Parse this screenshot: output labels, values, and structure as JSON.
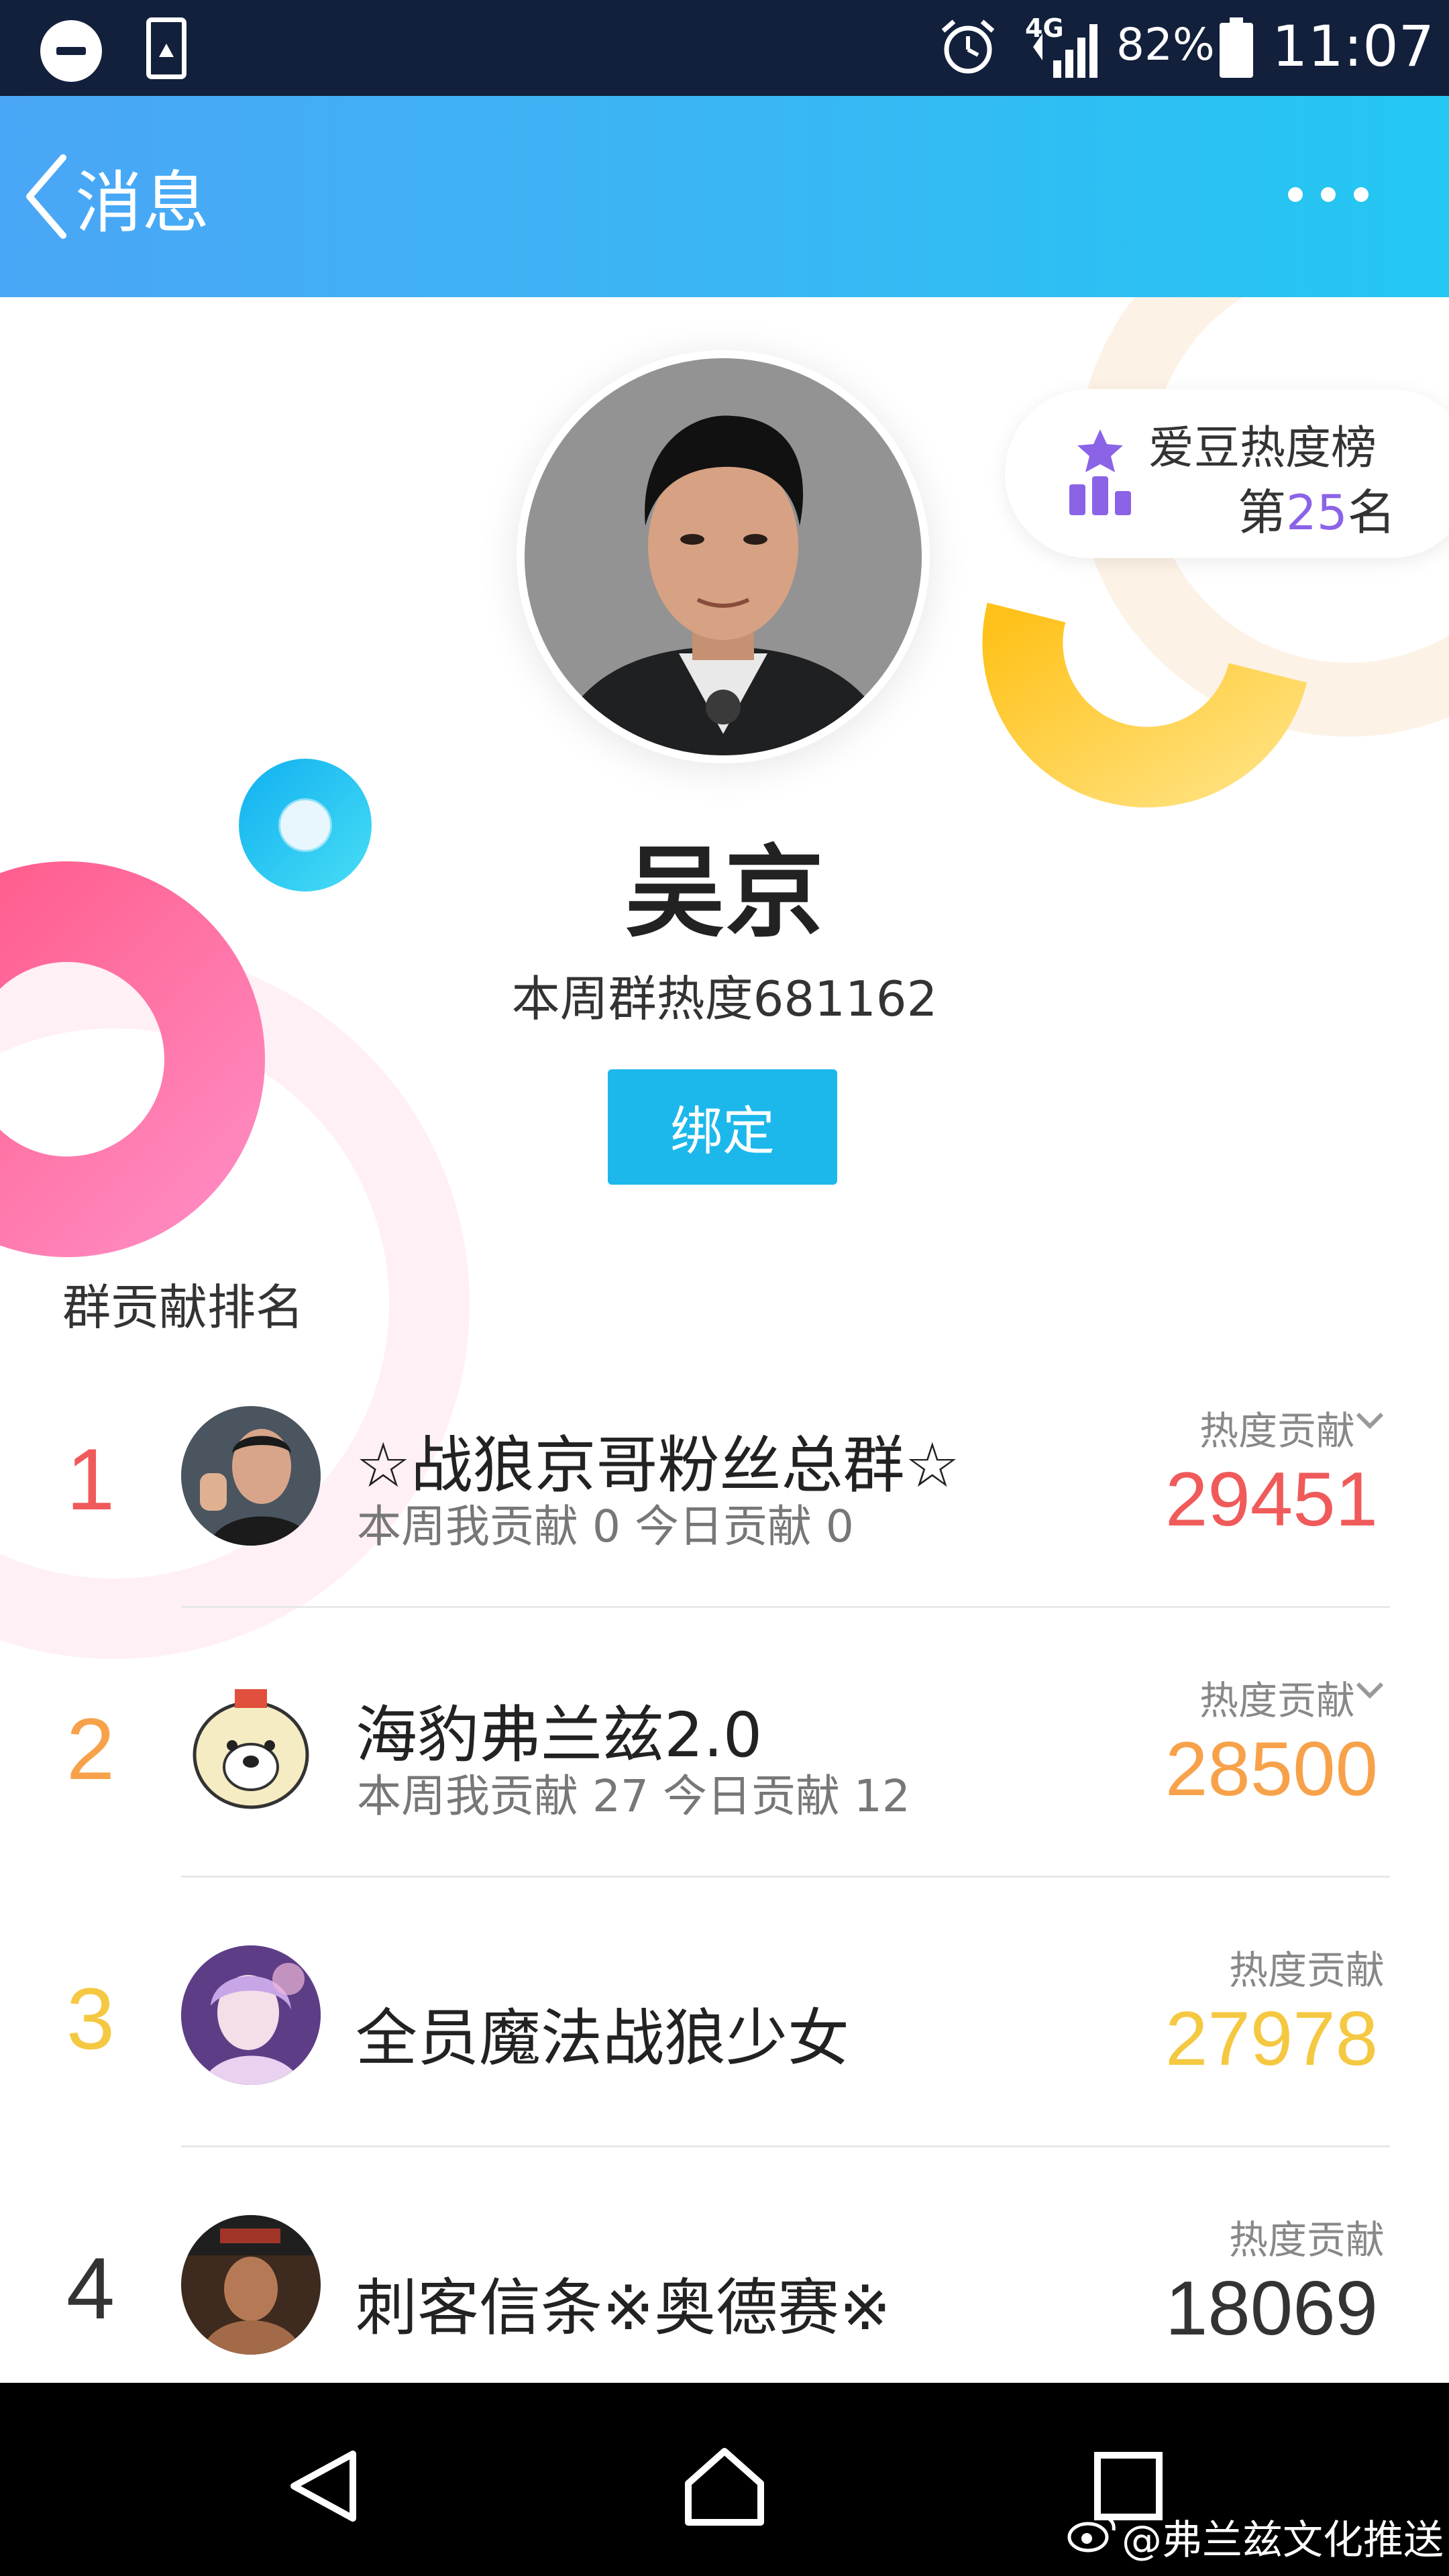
{
  "status_bar": {
    "network": "4G",
    "battery": "82%",
    "time": "11:07"
  },
  "nav": {
    "back_label": "消息"
  },
  "idol_rank_card": {
    "title": "爱豆热度榜",
    "prefix": "第",
    "rank": "25",
    "suffix": "名"
  },
  "profile": {
    "name": "吴京",
    "weekly_heat": "本周群热度681162",
    "bind_label": "绑定"
  },
  "section_title": "群贡献排名",
  "ranking": [
    {
      "rank": "1",
      "name": "☆战狼京哥粉丝总群☆",
      "sub": "本周我贡献 0  今日贡献 0",
      "heat_label": "热度贡献",
      "heat_value": "29451",
      "color": "#f05a5a",
      "has_arrow": true
    },
    {
      "rank": "2",
      "name": "海豹弗兰兹2.0",
      "sub": "本周我贡献 27  今日贡献 12",
      "heat_label": "热度贡献",
      "heat_value": "28500",
      "color": "#f7a24b",
      "has_arrow": true
    },
    {
      "rank": "3",
      "name": "全员魔法战狼少女",
      "sub": "",
      "heat_label": "热度贡献",
      "heat_value": "27978",
      "color": "#f5c842",
      "has_arrow": false
    },
    {
      "rank": "4",
      "name": "刺客信条※奥德赛※",
      "sub": "",
      "heat_label": "热度贡献",
      "heat_value": "18069",
      "color": "#333333",
      "has_arrow": false
    }
  ],
  "watermark": "@弗兰兹文化推送",
  "colors": {
    "nav_start": "#4aa6f6",
    "nav_end": "#23c7f2",
    "bind_button": "#1cb8ec",
    "rank_accent": "#8b63e6"
  },
  "icons": [
    "dnd-icon",
    "image-icon",
    "alarm-icon",
    "signal-icon",
    "battery-icon",
    "back-chevron-icon",
    "more-icon",
    "podium-star-icon",
    "nav-back-icon",
    "nav-home-icon",
    "nav-recents-icon",
    "weibo-icon"
  ]
}
